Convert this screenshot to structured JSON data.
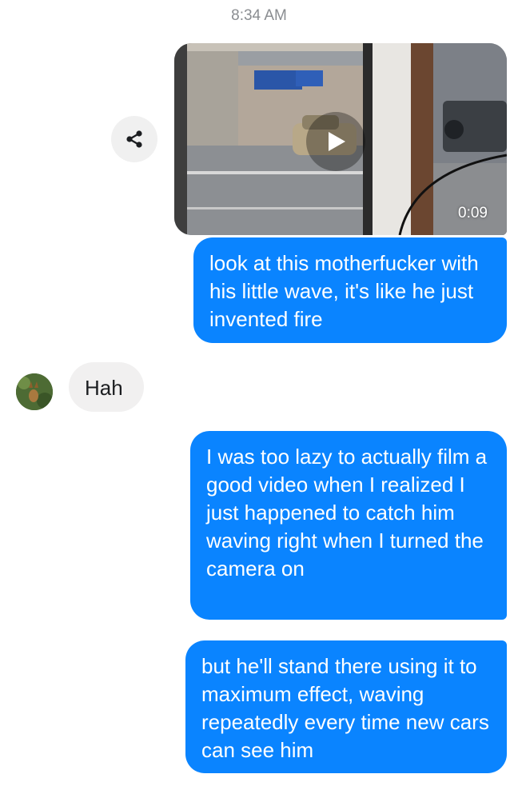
{
  "conversation": {
    "timestamp": "8:34 AM",
    "video": {
      "duration": "0:09",
      "share_icon": "share-icon",
      "play_icon": "play-icon"
    },
    "messages": [
      {
        "sender": "me",
        "text": "look at this motherfucker with his little wave, it's like he just invented fire"
      },
      {
        "sender": "other",
        "text": "Hah"
      },
      {
        "sender": "me",
        "text": "I was too lazy to actually film a good video when I realized I just happened to catch him waving right when I turned the camera on"
      },
      {
        "sender": "me",
        "text": "but he'll stand there using it to maximum effect, waving repeatedly every time new cars can see him"
      }
    ]
  },
  "colors": {
    "outgoing_bubble": "#0a84ff",
    "incoming_bubble": "#f1f0f0",
    "timestamp_text": "#8a8d91"
  }
}
